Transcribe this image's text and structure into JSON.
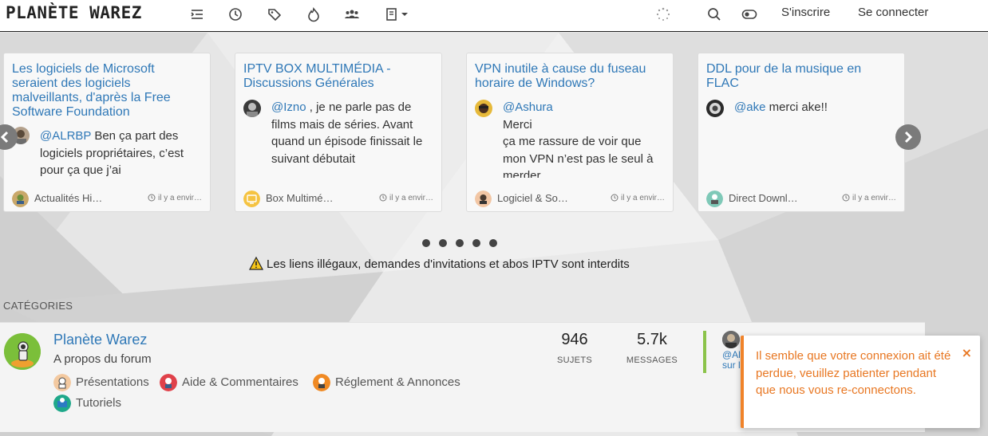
{
  "colors": {
    "link": "#2f78b7",
    "accent_orange": "#e87722",
    "category_green": "#8bc34a"
  },
  "navbar": {
    "logo": "PLANÈTE WAREZ",
    "icons": [
      "recent-icon",
      "clock-icon",
      "tags-icon",
      "popular-icon",
      "users-icon",
      "groups-icon"
    ],
    "register": "S'inscrire",
    "login": "Se connecter"
  },
  "carousel": {
    "cards": [
      {
        "title": "Les logiciels de Microsoft seraient des logiciels malveillants, d'après la Free Software Foundation",
        "mention": "@ALRBP",
        "text": " Ben ça part des logiciels propriétaires, c’est pour ça que j’ai",
        "category": "Actualités Hi…",
        "time": "il y a envir…"
      },
      {
        "title": "IPTV BOX MULTIMÉDIA - Discussions Générales",
        "mention": "@Izno",
        "text": " , je ne parle pas de films mais de séries. Avant quand un épisode finissait le suivant débutait",
        "category": "Box Multimé…",
        "time": "il y a envir…"
      },
      {
        "title": "VPN inutile à cause du fuseau horaire de Windows?",
        "mention": "@Ashura",
        "text_line1": "Merci",
        "text": "ça me rassure de voir que mon VPN n’est pas le seul à merder",
        "category": "Logiciel & So…",
        "time": "il y a envir…"
      },
      {
        "title": "DDL pour de la musique en FLAC",
        "mention": "@ake",
        "text": " merci ake!!",
        "category": "Direct Downl…",
        "time": "il y a envir…"
      }
    ],
    "dot_count": 5
  },
  "notice": "Les liens illégaux, demandes d'invitations et abos IPTV sont interdits",
  "categories": {
    "heading": "CATÉGORIES",
    "items": [
      {
        "title": "Planète Warez",
        "description": "A propos du forum",
        "subcategories": [
          "Présentations",
          "Aide & Commentaires",
          "Réglement & Annonces",
          "Tutoriels"
        ],
        "topics": "946",
        "topics_label": "SUJETS",
        "posts": "5.7k",
        "posts_label": "MESSAGES",
        "last_post_user": "@Al",
        "last_post_on": "sur l"
      }
    ]
  },
  "alert": {
    "message": "Il semble que votre connexion ait été perdue, veuillez patienter pendant que nous vous re-connectons.",
    "close": "×"
  }
}
